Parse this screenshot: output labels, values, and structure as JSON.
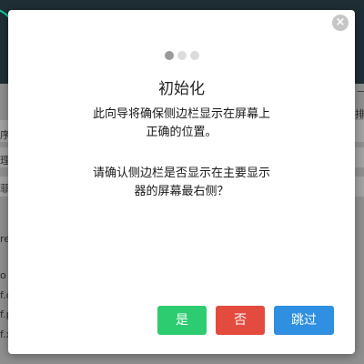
{
  "background": {
    "fragments": [
      "序",
      "理",
      "菲",
      "re",
      "f.c",
      "f.p",
      "f.x",
      "o",
      "排",
      "一"
    ]
  },
  "modal": {
    "close_icon": "×",
    "step_count": 3,
    "active_step": 1,
    "title": "初始化",
    "description_lines": [
      "此向导将确保侧边栏显示在屏幕上",
      "正确的位置。"
    ],
    "question_lines": [
      "请确认侧边栏是否显示在主要显示",
      "器的屏幕最右侧？"
    ],
    "buttons": {
      "yes": "是",
      "no": "否",
      "skip": "跳过"
    }
  },
  "colors": {
    "yes": "#2ecc71",
    "no": "#e34b3e",
    "skip": "#2f8fe0"
  }
}
